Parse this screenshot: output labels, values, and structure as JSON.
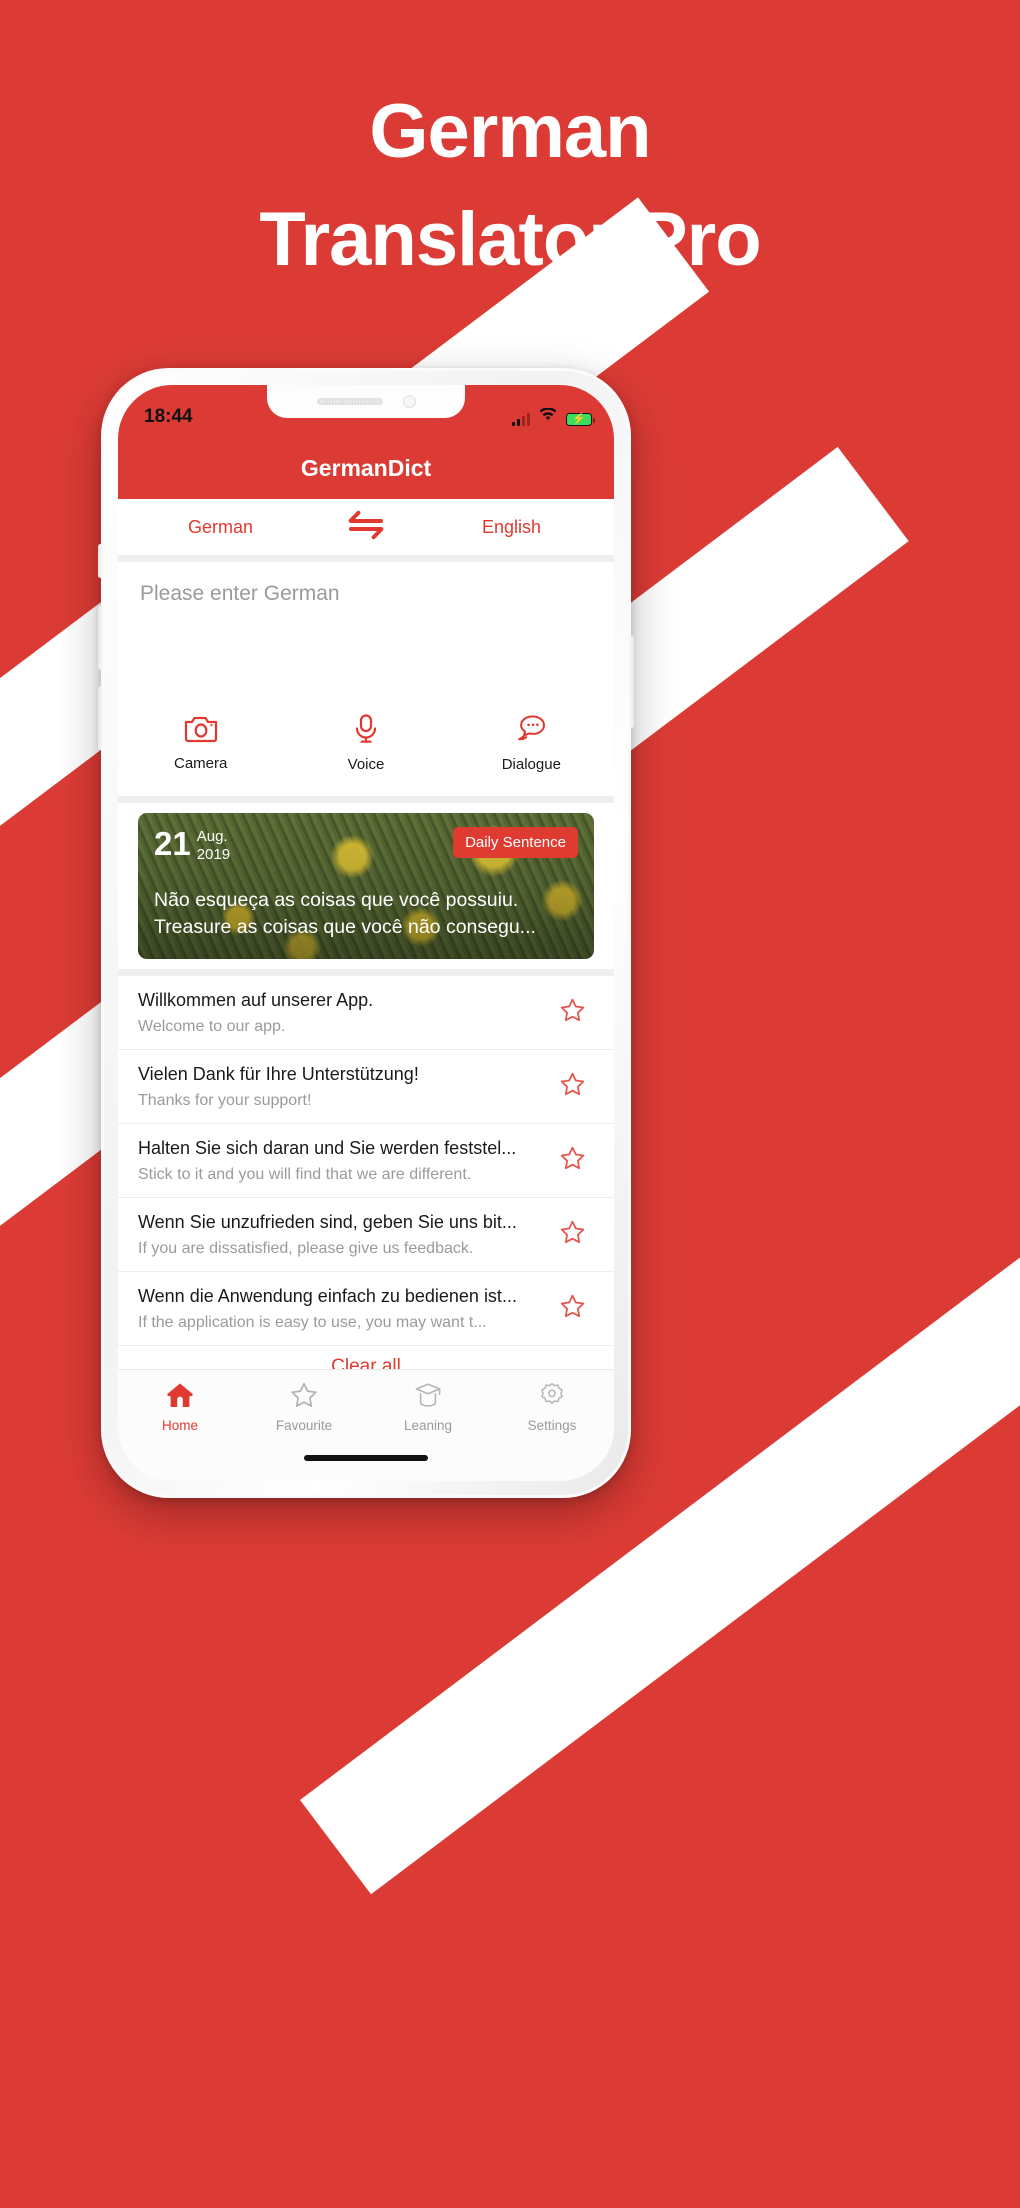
{
  "hero": {
    "line1": "German",
    "line2": "Translator Pro"
  },
  "theme": {
    "brand_red": "#DC3B35",
    "accent_red": "#E0392F",
    "battery_green": "#3DDC5C",
    "muted_gray": "#9B9B9B"
  },
  "phone": {
    "status_bar": {
      "time": "18:44",
      "signal_icon": "signal-bars-icon",
      "wifi_icon": "wifi-icon",
      "battery_icon": "battery-charging-icon"
    },
    "app_bar": {
      "title": "GermanDict"
    },
    "language_switch": {
      "source": "German",
      "target": "English",
      "swap_icon": "swap-arrows-icon"
    },
    "input": {
      "value": "",
      "placeholder": "Please enter German"
    },
    "actions": [
      {
        "label": "Camera",
        "icon": "camera-icon"
      },
      {
        "label": "Voice",
        "icon": "microphone-icon"
      },
      {
        "label": "Dialogue",
        "icon": "chat-bubbles-icon"
      }
    ],
    "daily_card": {
      "day": "21",
      "month": "Aug.",
      "year": "2019",
      "badge": "Daily Sentence",
      "quote_line1": "Não esqueça as coisas que você possuiu.",
      "quote_line2": "Treasure as coisas que você não consegu..."
    },
    "phrases": [
      {
        "source": "Willkommen auf unserer App.",
        "target": "Welcome to our app.",
        "star_icon": "star-outline-icon"
      },
      {
        "source": "Vielen Dank für Ihre Unterstützung!",
        "target": "Thanks for your support!",
        "star_icon": "star-outline-icon"
      },
      {
        "source": "Halten Sie sich daran und Sie werden feststel...",
        "target": "Stick to it and you will find that we are different.",
        "star_icon": "star-outline-icon"
      },
      {
        "source": "Wenn Sie unzufrieden sind, geben Sie uns bit...",
        "target": "If you are dissatisfied, please give us feedback.",
        "star_icon": "star-outline-icon"
      },
      {
        "source": "Wenn die Anwendung einfach zu bedienen ist...",
        "target": "If the application is easy to use, you may want t...",
        "star_icon": "star-outline-icon"
      }
    ],
    "clear_all": "Clear all",
    "tabs": [
      {
        "label": "Home",
        "icon": "home-icon",
        "active": true
      },
      {
        "label": "Favourite",
        "icon": "star-icon",
        "active": false
      },
      {
        "label": "Leaning",
        "icon": "graduation-cap-icon",
        "active": false
      },
      {
        "label": "Settings",
        "icon": "gear-icon",
        "active": false
      }
    ]
  }
}
